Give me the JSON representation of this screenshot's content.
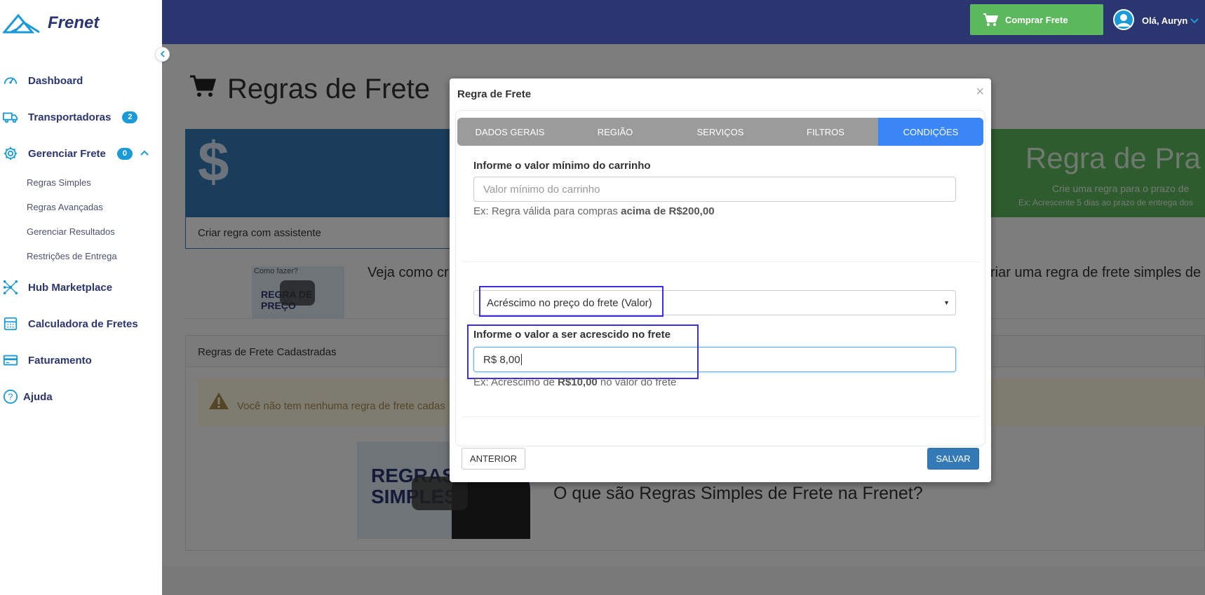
{
  "brand": {
    "name": "Frenet"
  },
  "sidebar": {
    "items": [
      {
        "label": "Dashboard",
        "icon": "dashboard-icon"
      },
      {
        "label": "Transportadoras",
        "icon": "truck-icon",
        "badge": "2"
      },
      {
        "label": "Gerenciar Frete",
        "icon": "gear-icon",
        "badge": "0",
        "expanded": true
      },
      {
        "label": "Hub Marketplace",
        "icon": "network-icon"
      },
      {
        "label": "Calculadora de Fretes",
        "icon": "calculator-icon"
      },
      {
        "label": "Faturamento",
        "icon": "credit-card-icon"
      },
      {
        "label": "Ajuda",
        "icon": "help-icon"
      }
    ],
    "subitems": [
      "Regras Simples",
      "Regras Avançadas",
      "Gerenciar Resultados",
      "Restrições de Entrega"
    ]
  },
  "topbar": {
    "buy_button": "Comprar Frete",
    "user_greeting": "Olá, Auryn"
  },
  "page": {
    "title": "Regras de Frete",
    "assistant_panel_footer": "Criar regra com assistente",
    "green_panel_title": "Regra de Pra",
    "green_panel_sub1": "Crie uma regra para o prazo de",
    "green_panel_sub2": "Ex: Acrescente 5 dias ao prazo de entrega dos",
    "howto_thumb_caption": "Como fazer?",
    "howto_thumb_title": "REGRA DE PREÇO",
    "howto_text_left": "Veja como cri",
    "howto_text_right": "riar uma regra de frete simples de p",
    "registered_header": "Regras de Frete Cadastradas",
    "warning_text": "Você não tem nenhuma regra de frete cadas",
    "video_title_line1": "REGRAS",
    "video_title_line2": "SIMPLES",
    "video_text": "O que são Regras Simples de Frete na Frenet?",
    "colors": {
      "navy": "#2b3570",
      "green": "#5cb85c",
      "blue": "#337ab7",
      "tab_active": "#3b86f7"
    }
  },
  "modal": {
    "title": "Regra de Frete",
    "close": "×",
    "tabs": [
      {
        "label": "DADOS GERAIS",
        "active": false
      },
      {
        "label": "REGIÃO",
        "active": false
      },
      {
        "label": "SERVIÇOS",
        "active": false
      },
      {
        "label": "FILTROS",
        "active": false
      },
      {
        "label": "CONDIÇÕES",
        "active": true
      }
    ],
    "min_cart": {
      "label": "Informe o valor mínimo do carrinho",
      "placeholder": "Valor mínimo do carrinho",
      "help_prefix": "Ex: Regra válida para compras ",
      "help_bold": "acima de R$200,00"
    },
    "condition_select": {
      "selected": "Acréscimo no preço do frete (Valor)"
    },
    "increase": {
      "label": "Informe o valor a ser acrescido no frete",
      "value": "R$ 8,00",
      "help_prefix": "Ex: Acréscimo de ",
      "help_bold": "R$10,00",
      "help_suffix": " no valor do frete"
    },
    "prev_button": "ANTERIOR",
    "save_button": "SALVAR"
  }
}
